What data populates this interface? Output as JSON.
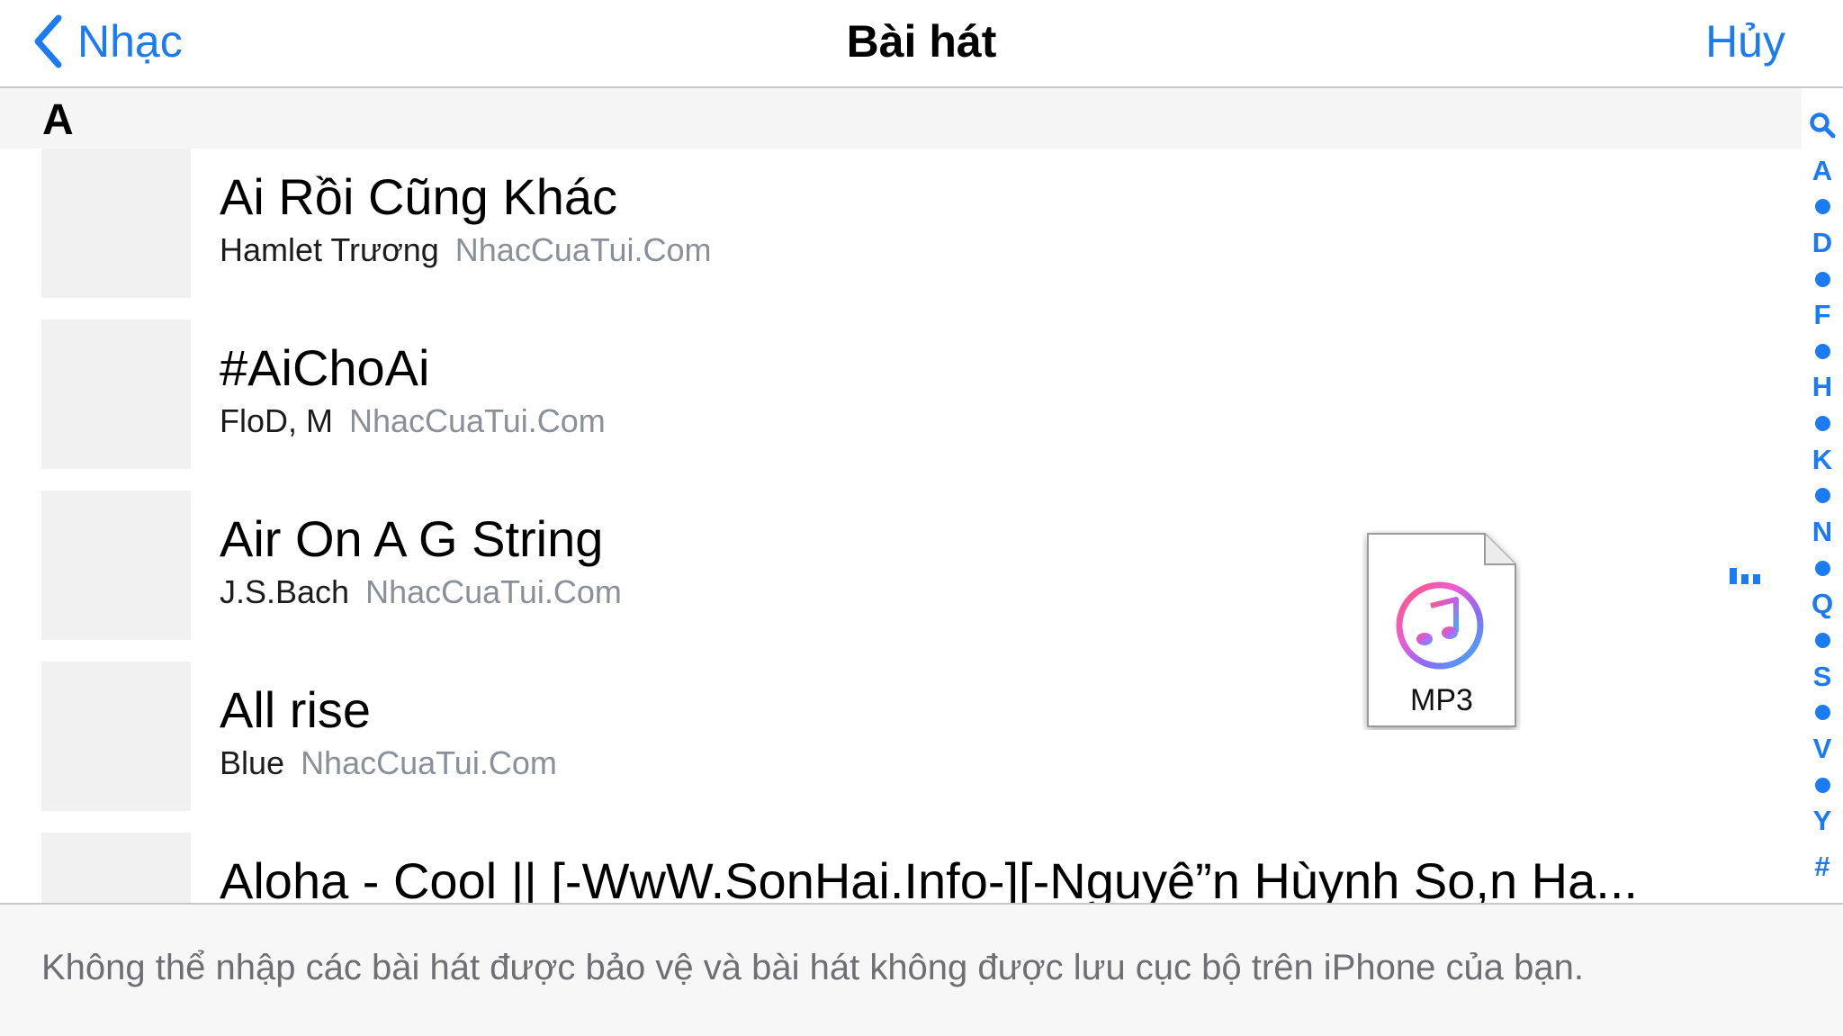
{
  "nav": {
    "back_label": "Nhạc",
    "title": "Bài hát",
    "cancel_label": "Hủy"
  },
  "section": {
    "letter": "A"
  },
  "songs": [
    {
      "title": "Ai Rồi Cũng Khác",
      "artist": "Hamlet Trương",
      "source": "NhacCuaTui.Com"
    },
    {
      "title": "#AiChoAi",
      "artist": "FloD, M",
      "source": "NhacCuaTui.Com"
    },
    {
      "title": "Air On A G String",
      "artist": "J.S.Bach",
      "source": "NhacCuaTui.Com"
    },
    {
      "title": "All rise",
      "artist": "Blue",
      "source": "NhacCuaTui.Com"
    },
    {
      "title": "Aloha - Cool || [-WwW.SonHai.Info-][-Nguyê”n Hùynh So,n Ha..."
    }
  ],
  "index": {
    "search_icon": "search-icon",
    "letters": [
      "A",
      "D",
      "F",
      "H",
      "K",
      "N",
      "Q",
      "S",
      "V",
      "Y",
      "#"
    ]
  },
  "drag_file": {
    "label": "MP3",
    "icon": "itunes-music-note-icon"
  },
  "footer": {
    "text": "Không thể nhập các bài hát được bảo vệ và bài hát không được lưu cục bộ trên iPhone của bạn."
  },
  "colors": {
    "accent": "#1a7bf2",
    "secondary_text": "#8a8f99",
    "artwork_placeholder": "#f1f1f1"
  }
}
